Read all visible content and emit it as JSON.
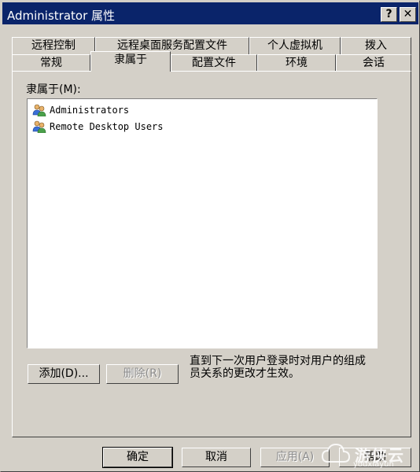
{
  "window": {
    "title": "Administrator 属性",
    "help_button": "?",
    "close_button": "✕"
  },
  "tabs": {
    "row_top": [
      "远程控制",
      "远程桌面服务配置文件",
      "个人虚拟机",
      "拨入"
    ],
    "row_bottom": [
      "常规",
      "隶属于",
      "配置文件",
      "环境",
      "会话"
    ],
    "active": "隶属于"
  },
  "member_of": {
    "label": "隶属于(M):",
    "items": [
      {
        "name": "Administrators",
        "icon": "group-icon"
      },
      {
        "name": "Remote Desktop Users",
        "icon": "group-icon"
      }
    ]
  },
  "buttons": {
    "add": "添加(D)...",
    "remove": "删除(R)",
    "ok": "确定",
    "cancel": "取消",
    "apply": "应用(A)",
    "help": "帮助"
  },
  "hint_text": "直到下一次用户登录时对用户的组成员关系的更改才生效。",
  "watermark": {
    "text": "游侠云",
    "sub": "youxiayun"
  },
  "colors": {
    "titlebar": "#0a246a",
    "face": "#d4d0c8",
    "listbox": "#ffffff"
  }
}
